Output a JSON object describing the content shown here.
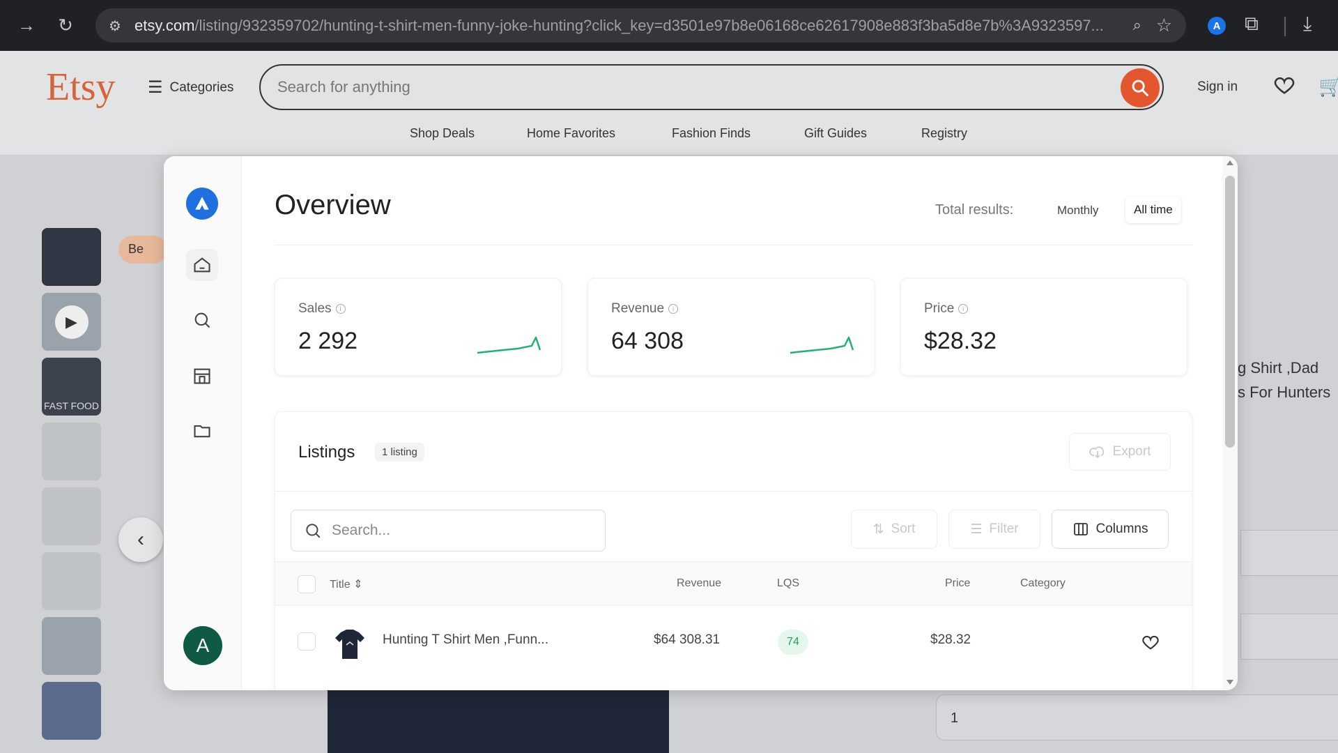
{
  "browser": {
    "url_host": "etsy.com",
    "url_path": "/listing/932359702/hunting-t-shirt-men-funny-joke-hunting?click_key=d3501e97b8e06168ce62617908e883f3ba5d8e7b%3A9323597...",
    "extension_letter": "A"
  },
  "etsy": {
    "logo": "Etsy",
    "categories": "Categories",
    "search_placeholder": "Search for anything",
    "sign_in": "Sign in",
    "nav": [
      "Shop Deals",
      "Home Favorites",
      "Fashion Finds",
      "Gift Guides",
      "Registry"
    ],
    "brand_color": "#d5643a",
    "search_button_color": "#e4572e"
  },
  "background_page": {
    "badge_text": "Be",
    "title_line1": "g Shirt ,Dad",
    "title_line2": "s For Hunters",
    "thumb_text_fast_food": "FAST FOOD",
    "quantity": "1"
  },
  "panel": {
    "title": "Overview",
    "total_results_label": "Total results:",
    "toggle_monthly": "Monthly",
    "toggle_all_time": "All time",
    "avatar_letter": "A",
    "stats": [
      {
        "label": "Sales",
        "value": "2 292"
      },
      {
        "label": "Revenue",
        "value": "64 308"
      },
      {
        "label": "Price",
        "value": "$28.32"
      }
    ],
    "listings": {
      "title": "Listings",
      "count_badge": "1 listing",
      "export": "Export",
      "search_placeholder": "Search...",
      "sort": "Sort",
      "filter": "Filter",
      "columns": "Columns",
      "headers": {
        "title": "Title",
        "revenue": "Revenue",
        "lqs": "LQS",
        "price": "Price",
        "category": "Category"
      },
      "rows": [
        {
          "title": "Hunting T Shirt Men ,Funn...",
          "revenue": "$64 308.31",
          "lqs": "74",
          "price": "$28.32",
          "category": ""
        }
      ]
    },
    "accent_color": "#1e6fe0",
    "sparkline_color": "#21b26b"
  }
}
